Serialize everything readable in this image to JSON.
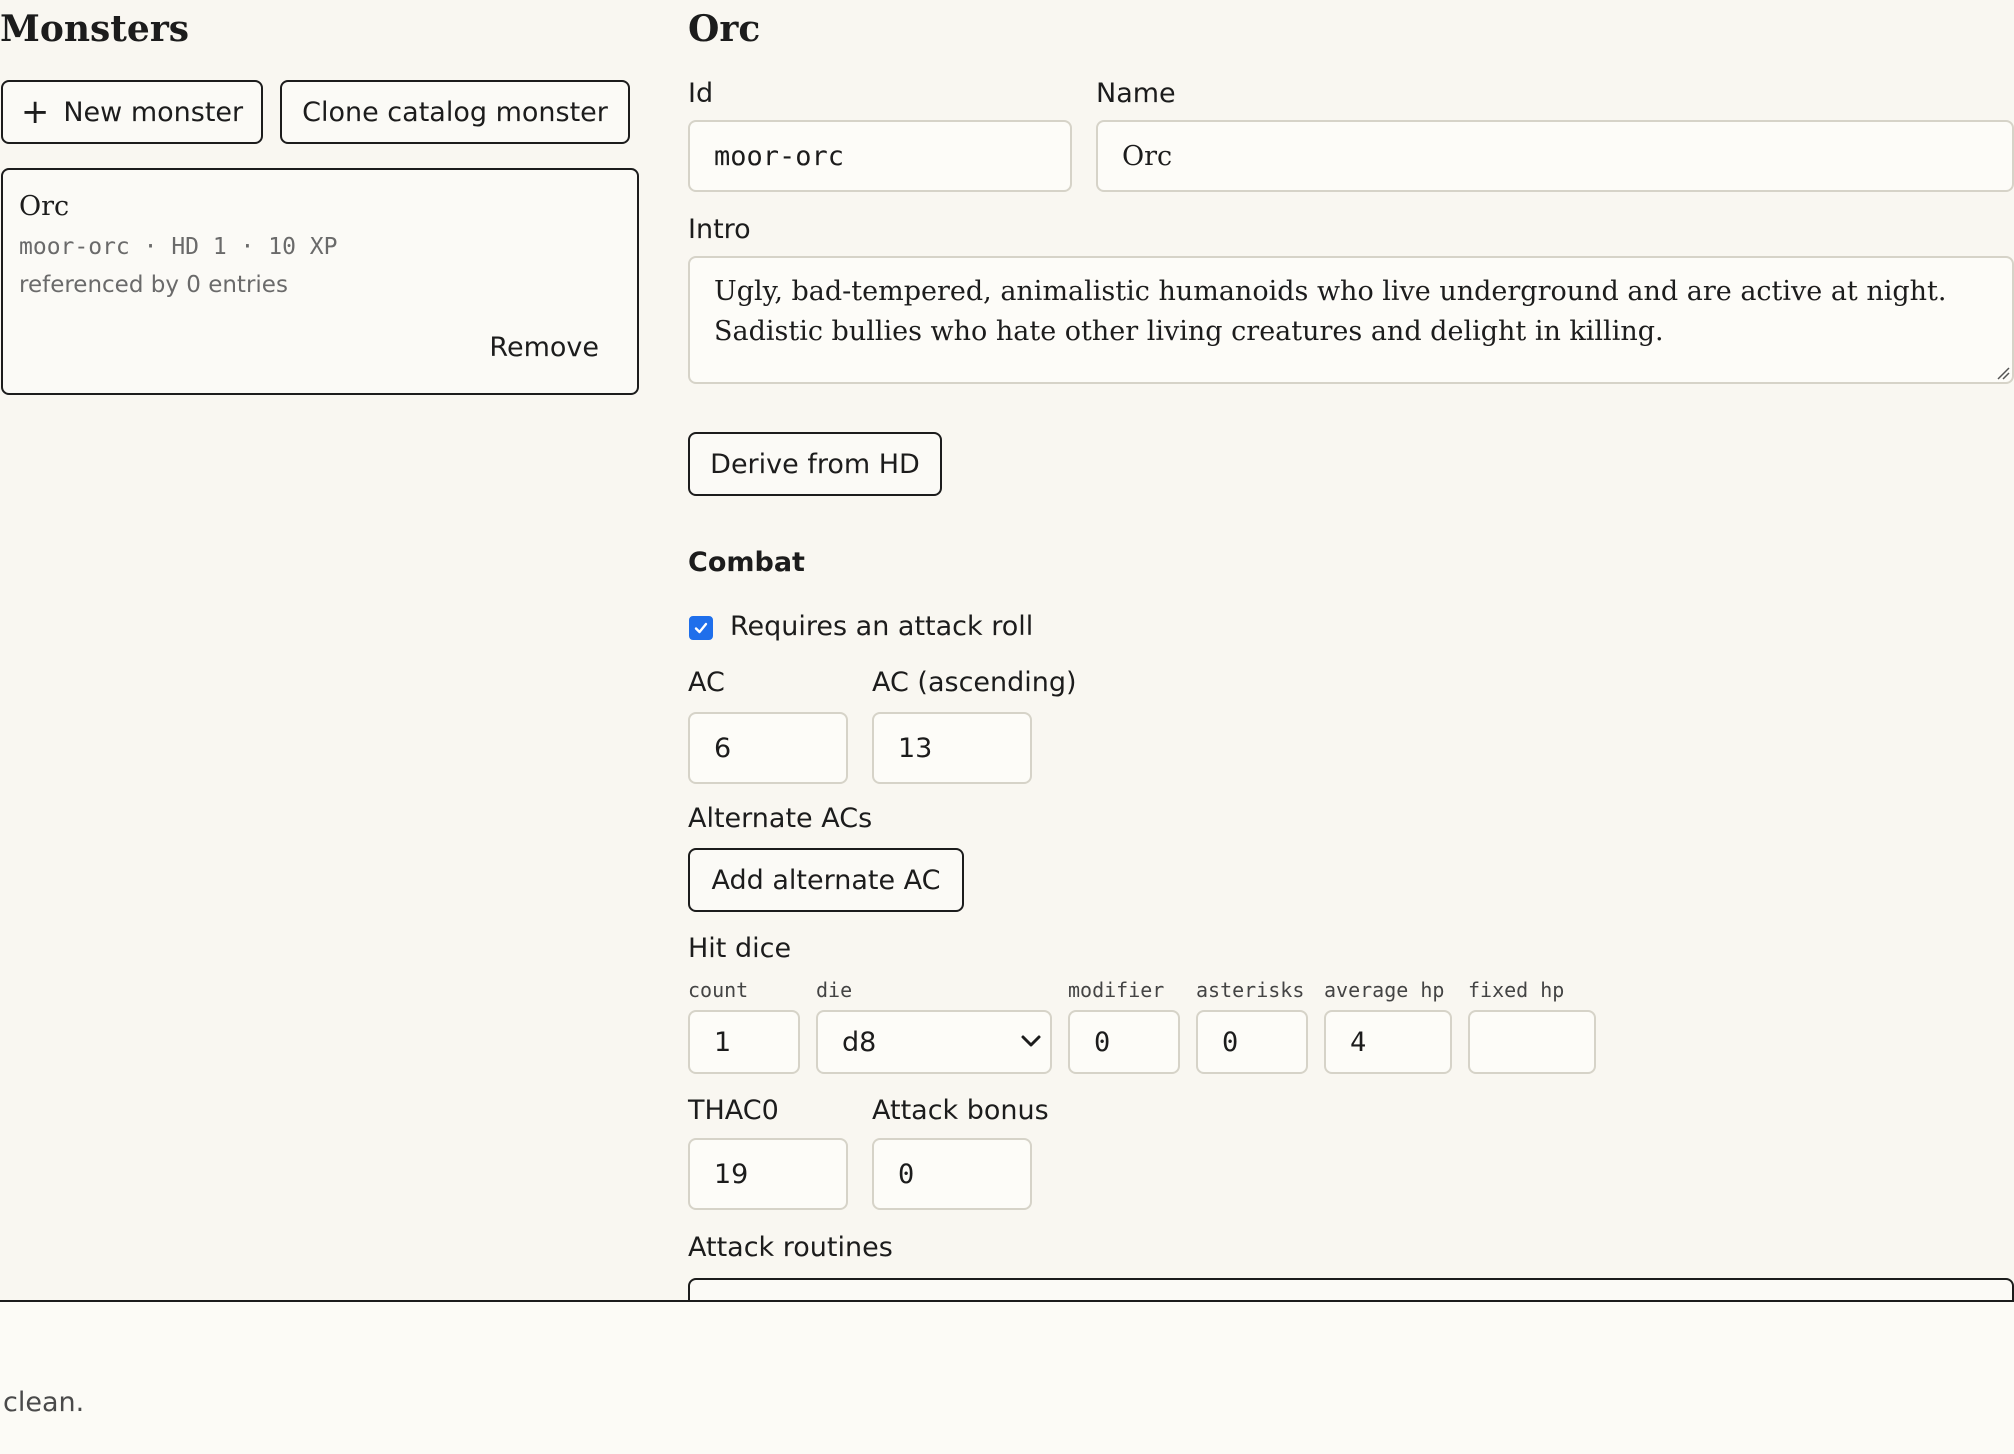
{
  "sidebar": {
    "title": "Monsters",
    "new_button": "New monster",
    "clone_button": "Clone catalog monster",
    "monsters": [
      {
        "name": "Orc",
        "meta": "moor-orc · HD 1 · 10 XP",
        "refs": "referenced by 0 entries",
        "remove_label": "Remove"
      }
    ]
  },
  "editor": {
    "title": "Orc",
    "id_label": "Id",
    "id_value": "moor-orc",
    "name_label": "Name",
    "name_value": "Orc",
    "intro_label": "Intro",
    "intro_value": "Ugly, bad-tempered, animalistic humanoids who live underground and are active at night. Sadistic bullies who hate other living creatures and delight in killing.",
    "derive_button": "Derive from HD",
    "combat": {
      "heading": "Combat",
      "attack_roll_label": "Requires an attack roll",
      "attack_roll_checked": true,
      "ac_label": "AC",
      "ac_value": "6",
      "ac_asc_label": "AC (ascending)",
      "ac_asc_value": "13",
      "alt_acs_label": "Alternate ACs",
      "add_alt_ac_button": "Add alternate AC",
      "hit_dice": {
        "label": "Hit dice",
        "count_label": "count",
        "count_value": "1",
        "die_label": "die",
        "die_value": "d8",
        "modifier_label": "modifier",
        "modifier_value": "0",
        "asterisks_label": "asterisks",
        "asterisks_value": "0",
        "average_hp_label": "average hp",
        "average_hp_value": "4",
        "fixed_hp_label": "fixed hp",
        "fixed_hp_value": ""
      },
      "thaco_label": "THAC0",
      "thaco_value": "19",
      "attack_bonus_label": "Attack bonus",
      "attack_bonus_value": "0",
      "attack_routines_label": "Attack routines"
    }
  },
  "status": {
    "text": "clean."
  },
  "icons": {
    "plus": "plus-icon",
    "check": "checkmark-icon",
    "chevron": "chevron-down-icon",
    "resize": "resize-grip-icon"
  },
  "colors": {
    "background": "#f9f7f1",
    "checkbox_accent": "#1f6feb",
    "border_dark": "#1c1c1c",
    "input_border": "#d6d3c8"
  }
}
